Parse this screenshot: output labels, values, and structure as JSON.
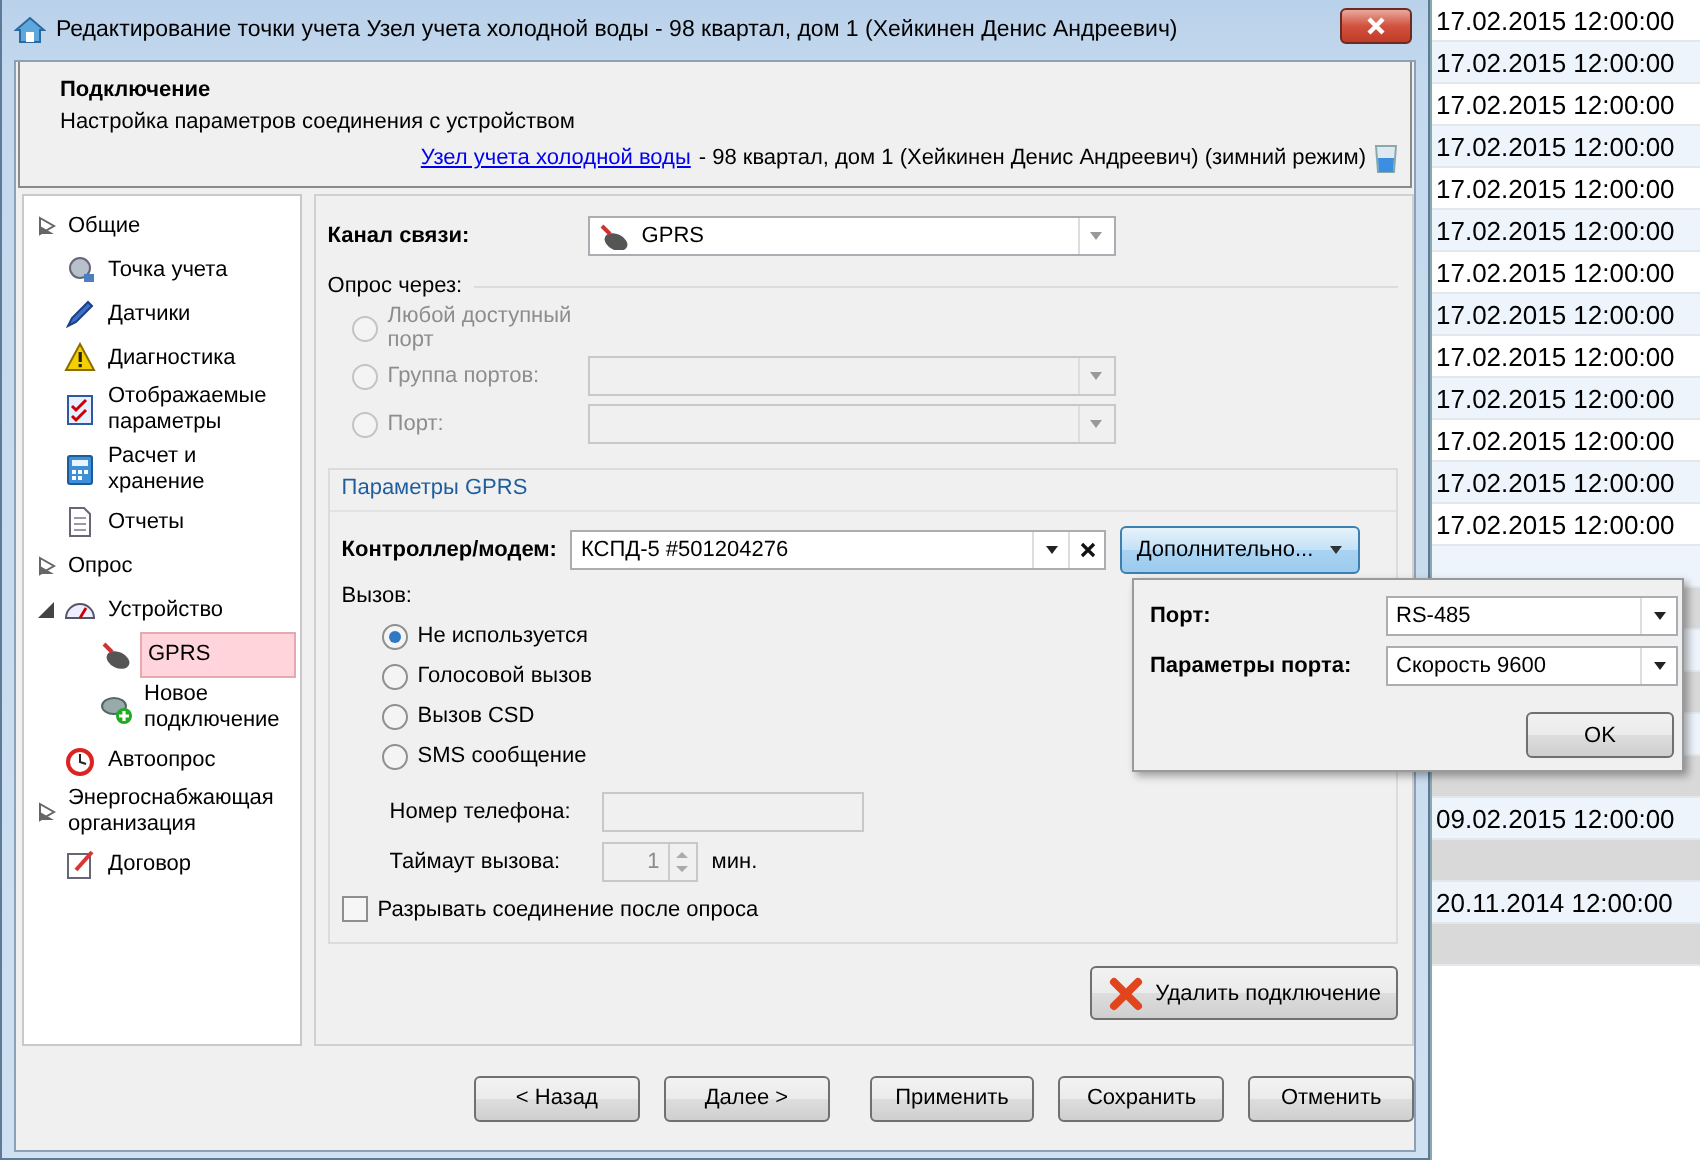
{
  "window": {
    "title": "Редактирование точки учета Узел учета холодной воды - 98 квартал, дом 1 (Хейкинен Денис Андреевич)"
  },
  "header": {
    "title": "Подключение",
    "subtitle": "Настройка параметров соединения с устройством",
    "link": "Узел учета холодной воды",
    "suffix": "- 98 квартал, дом 1 (Хейкинен Денис Андреевич) (зимний режим)"
  },
  "sidebar": {
    "items": [
      {
        "kind": "group",
        "label": "Общие",
        "expanded": false,
        "selected": false
      },
      {
        "kind": "item",
        "label": "Точка учета",
        "selected": false
      },
      {
        "kind": "item",
        "label": "Датчики",
        "selected": false
      },
      {
        "kind": "item",
        "label": "Диагностика",
        "selected": false
      },
      {
        "kind": "item",
        "label": "Отображаемые параметры",
        "selected": false
      },
      {
        "kind": "item",
        "label": "Расчет и хранение",
        "selected": false
      },
      {
        "kind": "item",
        "label": "Отчеты",
        "selected": false
      },
      {
        "kind": "group",
        "label": "Опрос",
        "expanded": false,
        "selected": false
      },
      {
        "kind": "node",
        "label": "Устройство",
        "expanded": true,
        "selected": false,
        "children": [
          {
            "label": "GPRS",
            "selected": true
          },
          {
            "label": "Новое подключение",
            "selected": false
          }
        ]
      },
      {
        "kind": "item",
        "label": "Автоопрос",
        "selected": false
      },
      {
        "kind": "group",
        "label": "Энергоснабжающая организация",
        "expanded": false,
        "selected": false
      },
      {
        "kind": "item",
        "label": "Договор",
        "selected": false
      }
    ]
  },
  "channel": {
    "label": "Канал связи:",
    "value": "GPRS",
    "disabled": false
  },
  "poll": {
    "label": "Опрос через:",
    "options": [
      {
        "kind": "plain",
        "label": "Любой доступный порт",
        "selected": false,
        "disabled": true
      },
      {
        "kind": "combo",
        "label": "Группа портов:",
        "selected": false,
        "disabled": true
      },
      {
        "kind": "combo",
        "label": "Порт:",
        "selected": false,
        "disabled": true
      }
    ]
  },
  "gprs": {
    "title": "Параметры GPRS",
    "controller": {
      "label": "Контроллер/модем:",
      "value": "КСПД-5 #501204276"
    },
    "more_button": "Дополнительно...",
    "call_label": "Вызов:",
    "call_options": [
      {
        "label": "Не используется",
        "selected": true
      },
      {
        "label": "Голосовой вызов",
        "selected": false
      },
      {
        "label": "Вызов CSD",
        "selected": false
      },
      {
        "label": "SMS сообщение",
        "selected": false
      }
    ],
    "phone": {
      "label": "Номер телефона:",
      "disabled": true
    },
    "timeout": {
      "label": "Таймаут вызова:",
      "value": "1",
      "unit": "мин.",
      "disabled": true
    },
    "disconnect": {
      "label": "Разрывать соединение после опроса",
      "checked": false
    }
  },
  "delete_button": "Удалить подключение",
  "popup": {
    "fields": [
      {
        "label": "Порт:",
        "value": "RS-485"
      },
      {
        "label": "Параметры порта:",
        "value": "Скорость 9600"
      }
    ],
    "ok": "OK"
  },
  "buttons": [
    "< Назад",
    "Далее >",
    "Применить",
    "Сохранить",
    "Отменить"
  ],
  "background_table": {
    "rows": [
      {
        "kind": "plain",
        "text": "17.02.2015 12:00:00"
      },
      {
        "kind": "plain",
        "text": "17.02.2015 12:00:00"
      },
      {
        "kind": "plain",
        "text": "17.02.2015 12:00:00"
      },
      {
        "kind": "plain",
        "text": "17.02.2015 12:00:00"
      },
      {
        "kind": "plain",
        "text": "17.02.2015 12:00:00"
      },
      {
        "kind": "plain",
        "text": "17.02.2015 12:00:00"
      },
      {
        "kind": "plain",
        "text": "17.02.2015 12:00:00"
      },
      {
        "kind": "plain",
        "text": "17.02.2015 12:00:00"
      },
      {
        "kind": "plain",
        "text": "17.02.2015 12:00:00"
      },
      {
        "kind": "plain",
        "text": "17.02.2015 12:00:00"
      },
      {
        "kind": "plain",
        "text": "17.02.2015 12:00:00"
      },
      {
        "kind": "plain",
        "text": "17.02.2015 12:00:00"
      },
      {
        "kind": "plain",
        "text": "17.02.2015 12:00:00"
      },
      {
        "kind": "plain"
      },
      {
        "kind": "shaded"
      },
      {
        "kind": "plain"
      },
      {
        "kind": "shaded"
      },
      {
        "kind": "plain"
      },
      {
        "kind": "shaded"
      },
      {
        "kind": "plain",
        "text": "09.02.2015 12:00:00"
      },
      {
        "kind": "shaded"
      },
      {
        "kind": "plain",
        "text": "20.11.2014 12:00:00"
      },
      {
        "kind": "shaded"
      }
    ]
  }
}
